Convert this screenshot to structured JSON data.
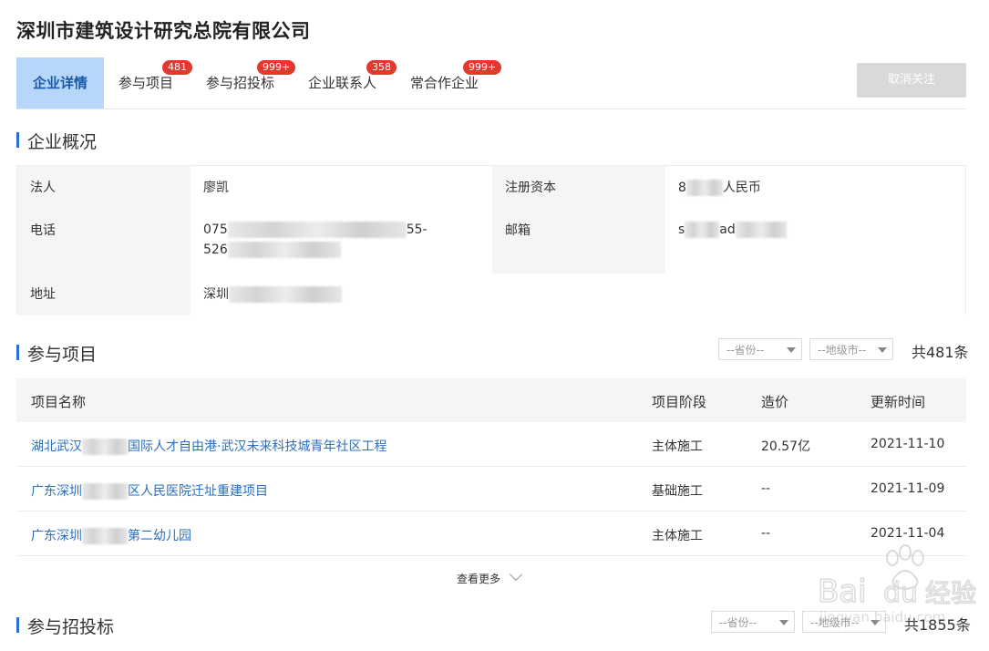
{
  "company": {
    "name": "深圳市建筑设计研究总院有限公司"
  },
  "tabs": [
    {
      "label": "企业详情",
      "badge": ""
    },
    {
      "label": "参与项目",
      "badge": "481"
    },
    {
      "label": "参与招投标",
      "badge": "999+"
    },
    {
      "label": "企业联系人",
      "badge": "358"
    },
    {
      "label": "常合作企业",
      "badge": "999+"
    }
  ],
  "actions": {
    "unfollow_label": "取消关注"
  },
  "overview": {
    "title": "企业概况",
    "legal_person_label": "法人",
    "legal_person_value": "廖凯",
    "capital_label": "注册资本",
    "capital_prefix": "8",
    "capital_suffix": "人民币",
    "phone_label": "电话",
    "phone_line1_prefix": "075",
    "phone_line1_suffix": "55-",
    "phone_line2_prefix": "526",
    "email_label": "邮箱",
    "email_prefix": "s",
    "email_mid": "ad",
    "address_label": "地址",
    "address_prefix": "深圳"
  },
  "projects": {
    "title": "参与项目",
    "province_placeholder": "--省份--",
    "city_placeholder": "--地级市--",
    "total": "共481条",
    "columns": [
      "项目名称",
      "项目阶段",
      "造价",
      "更新时间"
    ],
    "rows": [
      {
        "name_prefix": "湖北武汉",
        "name_suffix": "国际人才自由港·武汉未来科技城青年社区工程",
        "stage": "主体施工",
        "cost": "20.57亿",
        "date": "2021-11-10"
      },
      {
        "name_prefix": "广东深圳",
        "name_suffix": "区人民医院迁址重建项目",
        "stage": "基础施工",
        "cost": "--",
        "date": "2021-11-09"
      },
      {
        "name_prefix": "广东深圳",
        "name_suffix": "第二幼儿园",
        "stage": "主体施工",
        "cost": "--",
        "date": "2021-11-04"
      }
    ],
    "more_label": "查看更多"
  },
  "bids": {
    "title": "参与招投标",
    "province_placeholder": "--省份--",
    "city_placeholder": "--地级市--",
    "total": "共1855条"
  },
  "watermark": {
    "text": "Bai经验",
    "sub": "jingyan.baidu.com"
  },
  "colors": {
    "accent": "#2a6fc1",
    "active_tab_bg": "#b6d6fb",
    "badge": "#e03a2f"
  }
}
